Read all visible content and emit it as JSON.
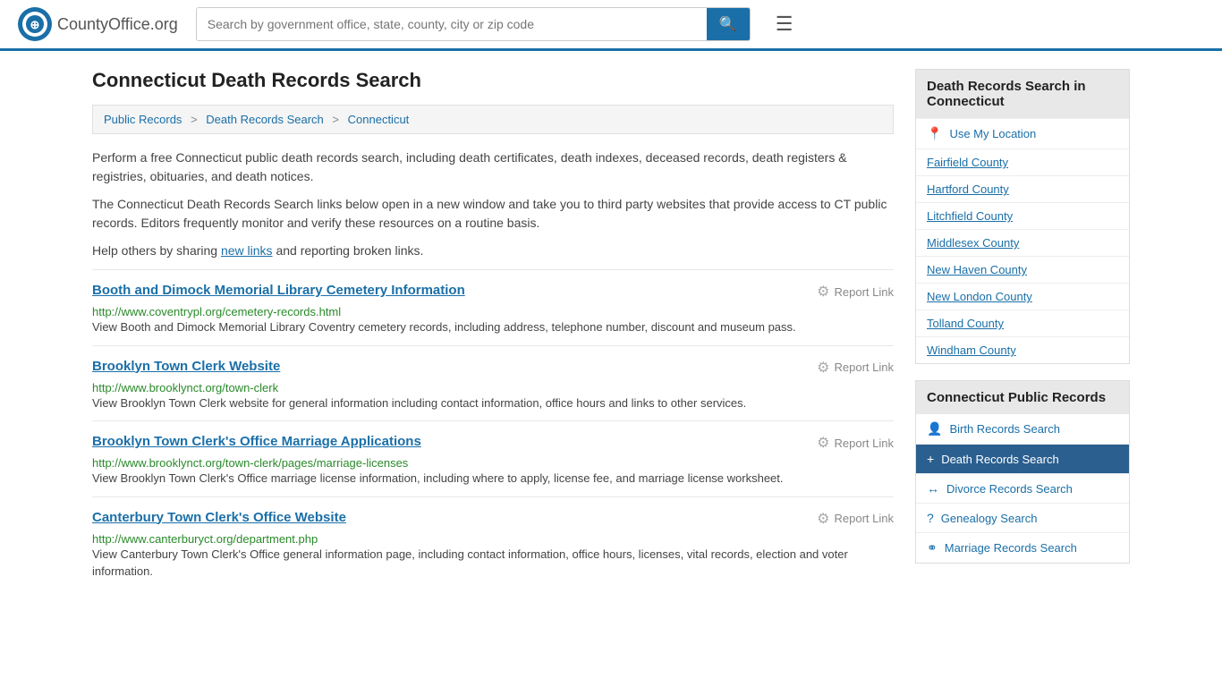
{
  "header": {
    "logo_text": "CountyOffice",
    "logo_suffix": ".org",
    "search_placeholder": "Search by government office, state, county, city or zip code",
    "search_button_icon": "🔍"
  },
  "page": {
    "title": "Connecticut Death Records Search",
    "breadcrumb": [
      {
        "label": "Public Records",
        "href": "#"
      },
      {
        "label": "Death Records Search",
        "href": "#"
      },
      {
        "label": "Connecticut",
        "href": "#"
      }
    ],
    "desc1": "Perform a free Connecticut public death records search, including death certificates, death indexes, deceased records, death registers & registries, obituaries, and death notices.",
    "desc2": "The Connecticut Death Records Search links below open in a new window and take you to third party websites that provide access to CT public records. Editors frequently monitor and verify these resources on a routine basis.",
    "desc3_pre": "Help others by sharing ",
    "desc3_link": "new links",
    "desc3_post": " and reporting broken links.",
    "results": [
      {
        "title": "Booth and Dimock Memorial Library Cemetery Information",
        "url": "http://www.coventrypl.org/cemetery-records.html",
        "desc": "View Booth and Dimock Memorial Library Coventry cemetery records, including address, telephone number, discount and museum pass.",
        "report_label": "Report Link"
      },
      {
        "title": "Brooklyn Town Clerk Website",
        "url": "http://www.brooklynct.org/town-clerk",
        "desc": "View Brooklyn Town Clerk website for general information including contact information, office hours and links to other services.",
        "report_label": "Report Link"
      },
      {
        "title": "Brooklyn Town Clerk's Office Marriage Applications",
        "url": "http://www.brooklynct.org/town-clerk/pages/marriage-licenses",
        "desc": "View Brooklyn Town Clerk's Office marriage license information, including where to apply, license fee, and marriage license worksheet.",
        "report_label": "Report Link"
      },
      {
        "title": "Canterbury Town Clerk's Office Website",
        "url": "http://www.canterburyct.org/department.php",
        "desc": "View Canterbury Town Clerk's Office general information page, including contact information, office hours, licenses, vital records, election and voter information.",
        "report_label": "Report Link"
      }
    ]
  },
  "sidebar": {
    "section1_title": "Death Records Search in Connecticut",
    "use_location_label": "Use My Location",
    "counties": [
      "Fairfield County",
      "Hartford County",
      "Litchfield County",
      "Middlesex County",
      "New Haven County",
      "New London County",
      "Tolland County",
      "Windham County"
    ],
    "section2_title": "Connecticut Public Records",
    "public_records": [
      {
        "label": "Birth Records Search",
        "icon": "👤",
        "active": false
      },
      {
        "label": "Death Records Search",
        "icon": "+",
        "active": true
      },
      {
        "label": "Divorce Records Search",
        "icon": "↔",
        "active": false
      },
      {
        "label": "Genealogy Search",
        "icon": "?",
        "active": false
      },
      {
        "label": "Marriage Records Search",
        "icon": "⚭",
        "active": false
      }
    ]
  }
}
